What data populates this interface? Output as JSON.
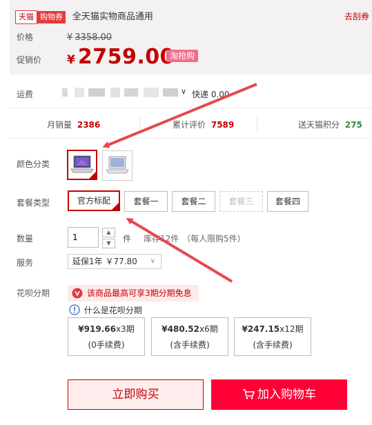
{
  "promo": {
    "tag_tmall": "天猫",
    "tag_coupon": "购物券",
    "text": "全天猫实物商品通用",
    "link": "去刮券"
  },
  "price": {
    "label": "价格",
    "currency": "¥",
    "original": "3358.00",
    "promo_label": "促销价",
    "promo_currency": "¥",
    "promo": "2759.00",
    "badge": "淘抢购"
  },
  "shipping": {
    "label": "运费",
    "method": "快递 0.00"
  },
  "stats": {
    "monthly_label": "月销量",
    "monthly_value": "2386",
    "reviews_label": "累计评价",
    "reviews_value": "7589",
    "points_label": "送天猫积分",
    "points_value": "275"
  },
  "color": {
    "label": "颜色分类"
  },
  "package": {
    "label": "套餐类型",
    "options": [
      "官方标配",
      "套餐一",
      "套餐二",
      "套餐三",
      "套餐四"
    ]
  },
  "quantity": {
    "label": "数量",
    "value": "1",
    "unit": "件",
    "stock": "库存12件",
    "limit": "（每人限购5件）"
  },
  "service": {
    "label": "服务",
    "selected": "延保1年 ￥77.80"
  },
  "huabei": {
    "label": "花呗分期",
    "note": "该商品最高可享3期分期免息",
    "help": "什么是花呗分期",
    "plans": [
      {
        "amount": "¥919.66",
        "periods": "x3期",
        "fee": "(0手续费)"
      },
      {
        "amount": "¥480.52",
        "periods": "x6期",
        "fee": "(含手续费)"
      },
      {
        "amount": "¥247.15",
        "periods": "x12期",
        "fee": "(含手续费)"
      }
    ]
  },
  "actions": {
    "buy_now": "立即购买",
    "add_cart": "加入购物车"
  },
  "colors": {
    "brand_red": "#c40000",
    "cart_red": "#ff0036",
    "points_green": "#2b8a3e"
  }
}
